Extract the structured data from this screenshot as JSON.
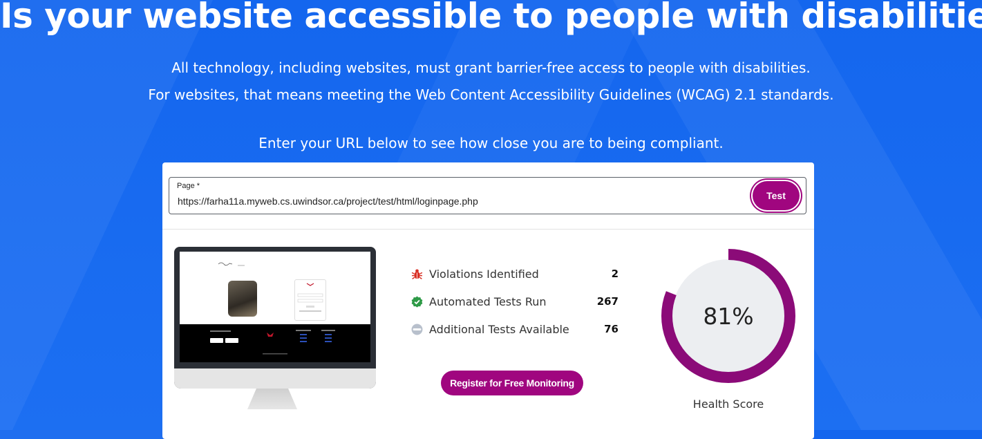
{
  "hero": {
    "title": "Is your website accessible to people with disabilities?",
    "line1": "All technology, including websites, must grant barrier-free access to people with disabilities.",
    "line2": "For websites, that means meeting the Web Content Accessibility Guidelines (WCAG) 2.1 standards.",
    "line3": "Enter your URL below to see how close you are to being compliant."
  },
  "form": {
    "label": "Page *",
    "url": "https://farha11a.myweb.cs.uwindsor.ca/project/test/html/loginpage.php",
    "test_button": "Test"
  },
  "stats": [
    {
      "icon": "bug-icon",
      "label": "Violations Identified",
      "value": "2",
      "color": "#d93025"
    },
    {
      "icon": "check-badge-icon",
      "label": "Automated Tests Run",
      "value": "267",
      "color": "#2e9a47"
    },
    {
      "icon": "minus-circle-icon",
      "label": "Additional Tests Available",
      "value": "76",
      "color": "#b8c0cc"
    }
  ],
  "register_button": "Register for Free Monitoring",
  "health": {
    "score": 81,
    "label": "81%",
    "caption": "Health Score",
    "ring_color": "#8b0b78",
    "track_color": "#eceef1"
  }
}
